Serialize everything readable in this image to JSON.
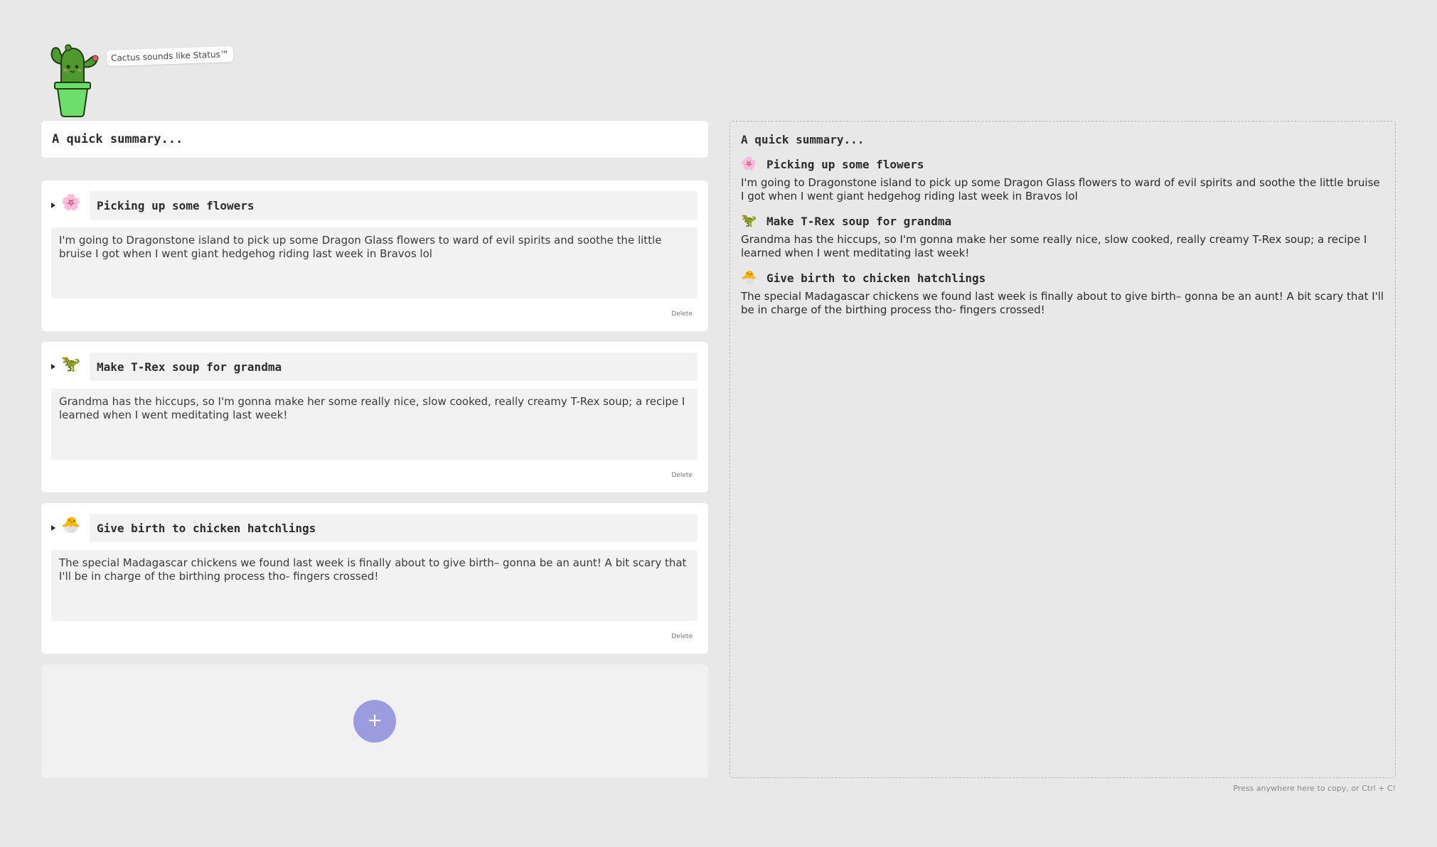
{
  "brand": {
    "tagline": "Cactus sounds like Status™",
    "logo_icon": "cactus-pot-icon"
  },
  "editor": {
    "title_placeholder": "A quick summary...",
    "delete_label": "Delete",
    "add_label": "+"
  },
  "entries": [
    {
      "emoji": "🌸",
      "emoji_name": "cherry-blossom-icon",
      "title": "Picking up some flowers",
      "body": "I'm going to Dragonstone island to pick up some Dragon Glass flowers to ward of evil spirits and soothe the little bruise I got when I went giant hedgehog riding last week in Bravos lol"
    },
    {
      "emoji": "🦖",
      "emoji_name": "t-rex-icon",
      "title": "Make T-Rex soup for grandma",
      "body": "Grandma has the hiccups, so I'm gonna make her some really nice, slow cooked, really creamy T-Rex soup; a recipe I learned when I went meditating last week!"
    },
    {
      "emoji": "🐣",
      "emoji_name": "hatching-chick-icon",
      "title": "Give birth to chicken hatchlings",
      "body": "The special Madagascar chickens we found last week is finally about to give birth– gonna be an aunt! A bit scary that I'll be in charge of the birthing process tho- fingers crossed!"
    }
  ],
  "preview": {
    "title": "A quick summary...",
    "copy_hint": "Press anywhere here to copy, or Ctrl + C!"
  },
  "colors": {
    "background": "#e8e8e8",
    "card": "#ffffff",
    "field": "#f2f2f2",
    "accent": "#9b9be0"
  }
}
